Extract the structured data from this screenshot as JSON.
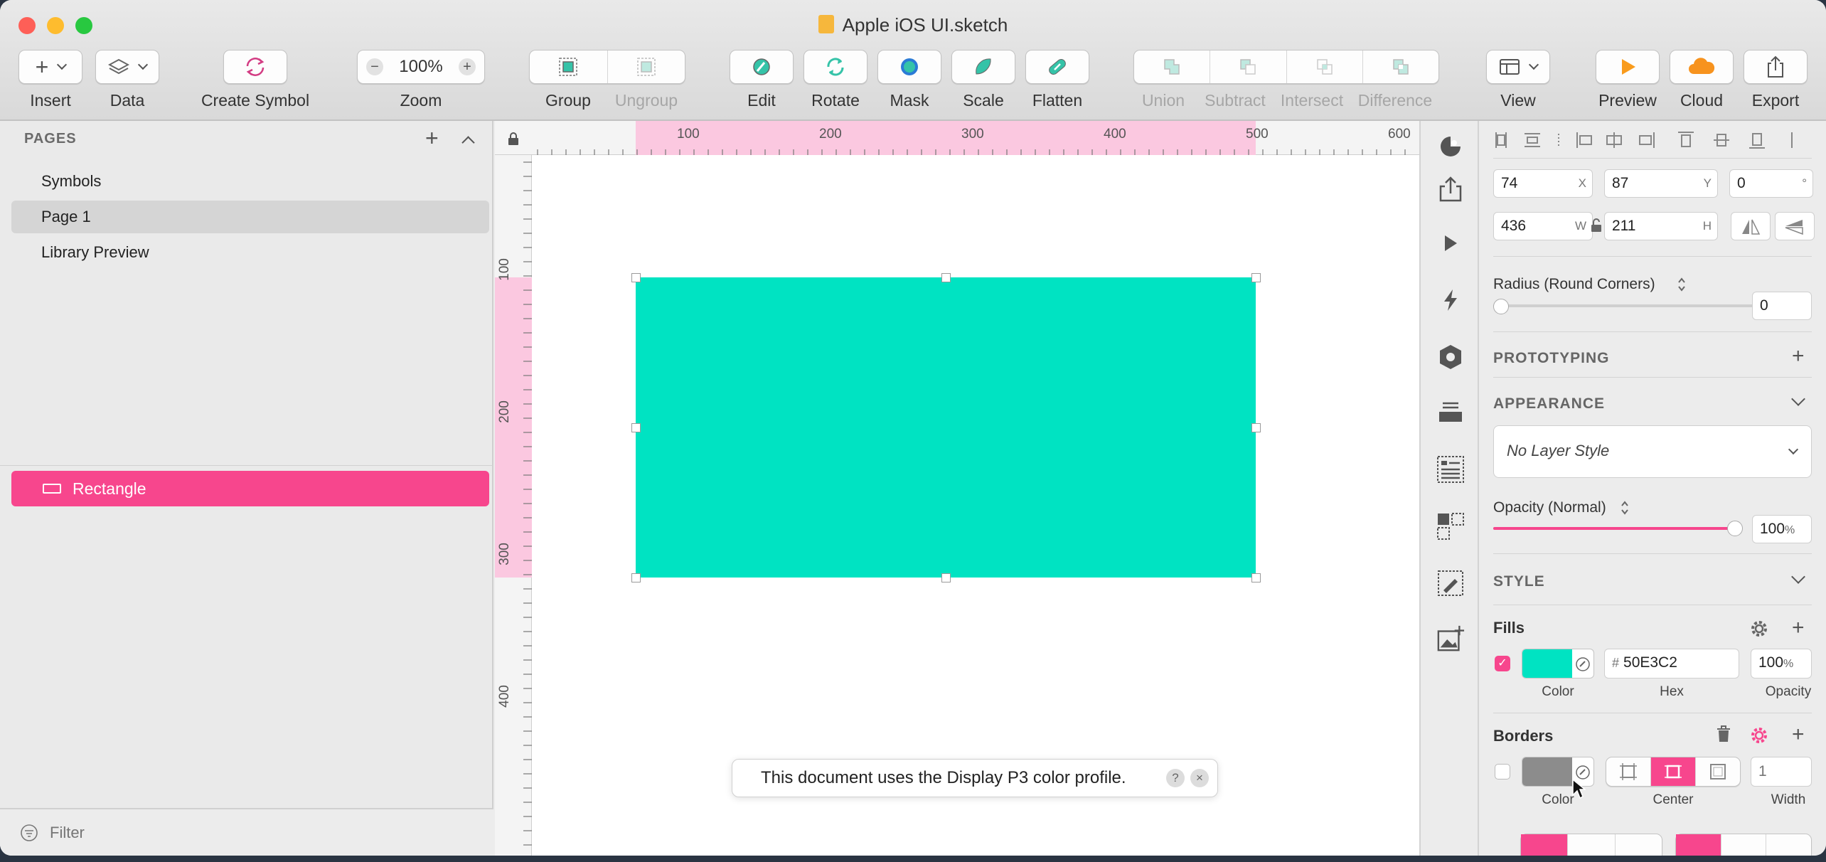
{
  "window": {
    "title": "Apple iOS UI.sketch"
  },
  "toolbar": {
    "insert": "Insert",
    "data": "Data",
    "create_symbol": "Create Symbol",
    "zoom_value": "100%",
    "zoom": "Zoom",
    "group": "Group",
    "ungroup": "Ungroup",
    "edit": "Edit",
    "rotate": "Rotate",
    "mask": "Mask",
    "scale": "Scale",
    "flatten": "Flatten",
    "union": "Union",
    "subtract": "Subtract",
    "intersect": "Intersect",
    "difference": "Difference",
    "view": "View",
    "preview": "Preview",
    "cloud": "Cloud",
    "export": "Export"
  },
  "pages": {
    "header": "PAGES",
    "items": [
      "Symbols",
      "Page 1",
      "Library Preview"
    ],
    "selected": "Page 1"
  },
  "layers": {
    "items": [
      "Rectangle"
    ]
  },
  "filter": {
    "placeholder": "Filter"
  },
  "rulers": {
    "h": [
      "100",
      "200",
      "300",
      "400",
      "500",
      "600"
    ],
    "v": [
      "100",
      "200",
      "300",
      "400"
    ]
  },
  "canvas": {
    "rect_color": "#00e3c2"
  },
  "toast": {
    "message": "This document uses the Display P3 color profile.",
    "help": "?",
    "close": "×"
  },
  "inspector": {
    "x": "74",
    "x_label": "X",
    "y": "87",
    "y_label": "Y",
    "rotation": "0",
    "rotation_unit": "°",
    "w": "436",
    "w_label": "W",
    "h": "211",
    "h_label": "H",
    "radius_label": "Radius (Round Corners)",
    "radius": "0",
    "prototyping": "PROTOTYPING",
    "appearance": "APPEARANCE",
    "layer_style": "No Layer Style",
    "opacity_label": "Opacity (Normal)",
    "opacity": "100",
    "opacity_pct": "%",
    "opacity_level": 1.0,
    "style": "STYLE",
    "fills": "Fills",
    "fill_hex_prefix": "#",
    "fill_hex": "50E3C2",
    "fill_opacity": "100",
    "fill_opacity_pct": "%",
    "cap_color": "Color",
    "cap_hex": "Hex",
    "cap_opacity": "Opacity",
    "borders": "Borders",
    "border_width_placeholder": "1",
    "cap_border_color": "Color",
    "cap_center": "Center",
    "cap_width": "Width",
    "accent": "#f7468d"
  }
}
